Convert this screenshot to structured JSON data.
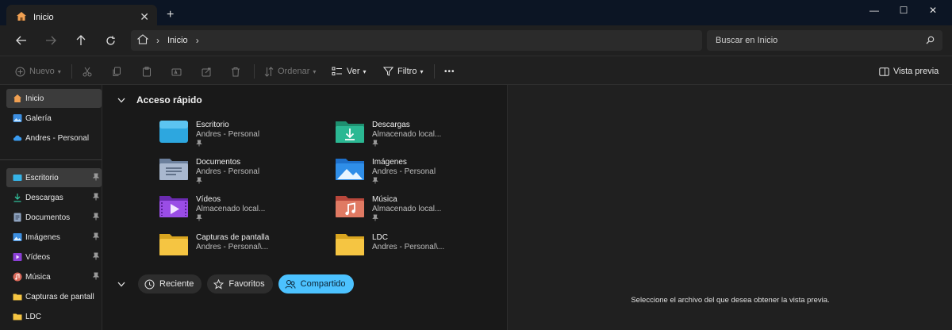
{
  "tab": {
    "title": "Inicio",
    "close": "✕",
    "new": "+"
  },
  "window_controls": {
    "minimize": "—",
    "maximize": "☐",
    "close": "✕"
  },
  "address": {
    "crumb": "Inicio",
    "sep1": "›",
    "sep2": "›"
  },
  "search": {
    "placeholder": "Buscar en Inicio"
  },
  "toolbar": {
    "new_label": "Nuevo",
    "sort_label": "Ordenar",
    "view_label": "Ver",
    "filter_label": "Filtro",
    "more_label": "•••",
    "preview_label": "Vista previa"
  },
  "sidebar": {
    "items": [
      {
        "label": "Inicio",
        "icon": "home-icon"
      },
      {
        "label": "Galería",
        "icon": "gallery-icon"
      },
      {
        "label": "Andres - Personal",
        "icon": "onedrive-icon"
      },
      {
        "label": "Escritorio",
        "icon": "desktop-icon"
      },
      {
        "label": "Descargas",
        "icon": "download-icon"
      },
      {
        "label": "Documentos",
        "icon": "documents-icon"
      },
      {
        "label": "Imágenes",
        "icon": "pictures-icon"
      },
      {
        "label": "Vídeos",
        "icon": "videos-icon"
      },
      {
        "label": "Música",
        "icon": "music-icon"
      },
      {
        "label": "Capturas de pantall",
        "icon": "folder-icon"
      },
      {
        "label": "LDC",
        "icon": "folder-icon"
      }
    ]
  },
  "quick_access": {
    "title": "Acceso rápido",
    "items": [
      {
        "name": "Escritorio",
        "sub": "Andres - Personal",
        "icon": "desktop-folder-icon"
      },
      {
        "name": "Descargas",
        "sub": "Almacenado local...",
        "icon": "downloads-folder-icon"
      },
      {
        "name": "Documentos",
        "sub": "Andres - Personal",
        "icon": "documents-folder-icon"
      },
      {
        "name": "Imágenes",
        "sub": "Andres - Personal",
        "icon": "pictures-folder-icon"
      },
      {
        "name": "Vídeos",
        "sub": "Almacenado local...",
        "icon": "videos-folder-icon"
      },
      {
        "name": "Música",
        "sub": "Almacenado local...",
        "icon": "music-folder-icon"
      },
      {
        "name": "Capturas de pantalla",
        "sub": "Andres - Personal\\...",
        "icon": "folder-icon"
      },
      {
        "name": "LDC",
        "sub": "Andres - Personal\\...",
        "icon": "folder-icon"
      }
    ]
  },
  "filters": {
    "recent": "Reciente",
    "favorites": "Favoritos",
    "shared": "Compartido",
    "active": "Compartido"
  },
  "preview_pane": {
    "message": "Seleccione el archivo del que desea obtener la vista previa."
  },
  "colors": {
    "accent": "#4cc2ff",
    "folder_yellow": "#f5c542",
    "titlebar": "#0c1524"
  }
}
